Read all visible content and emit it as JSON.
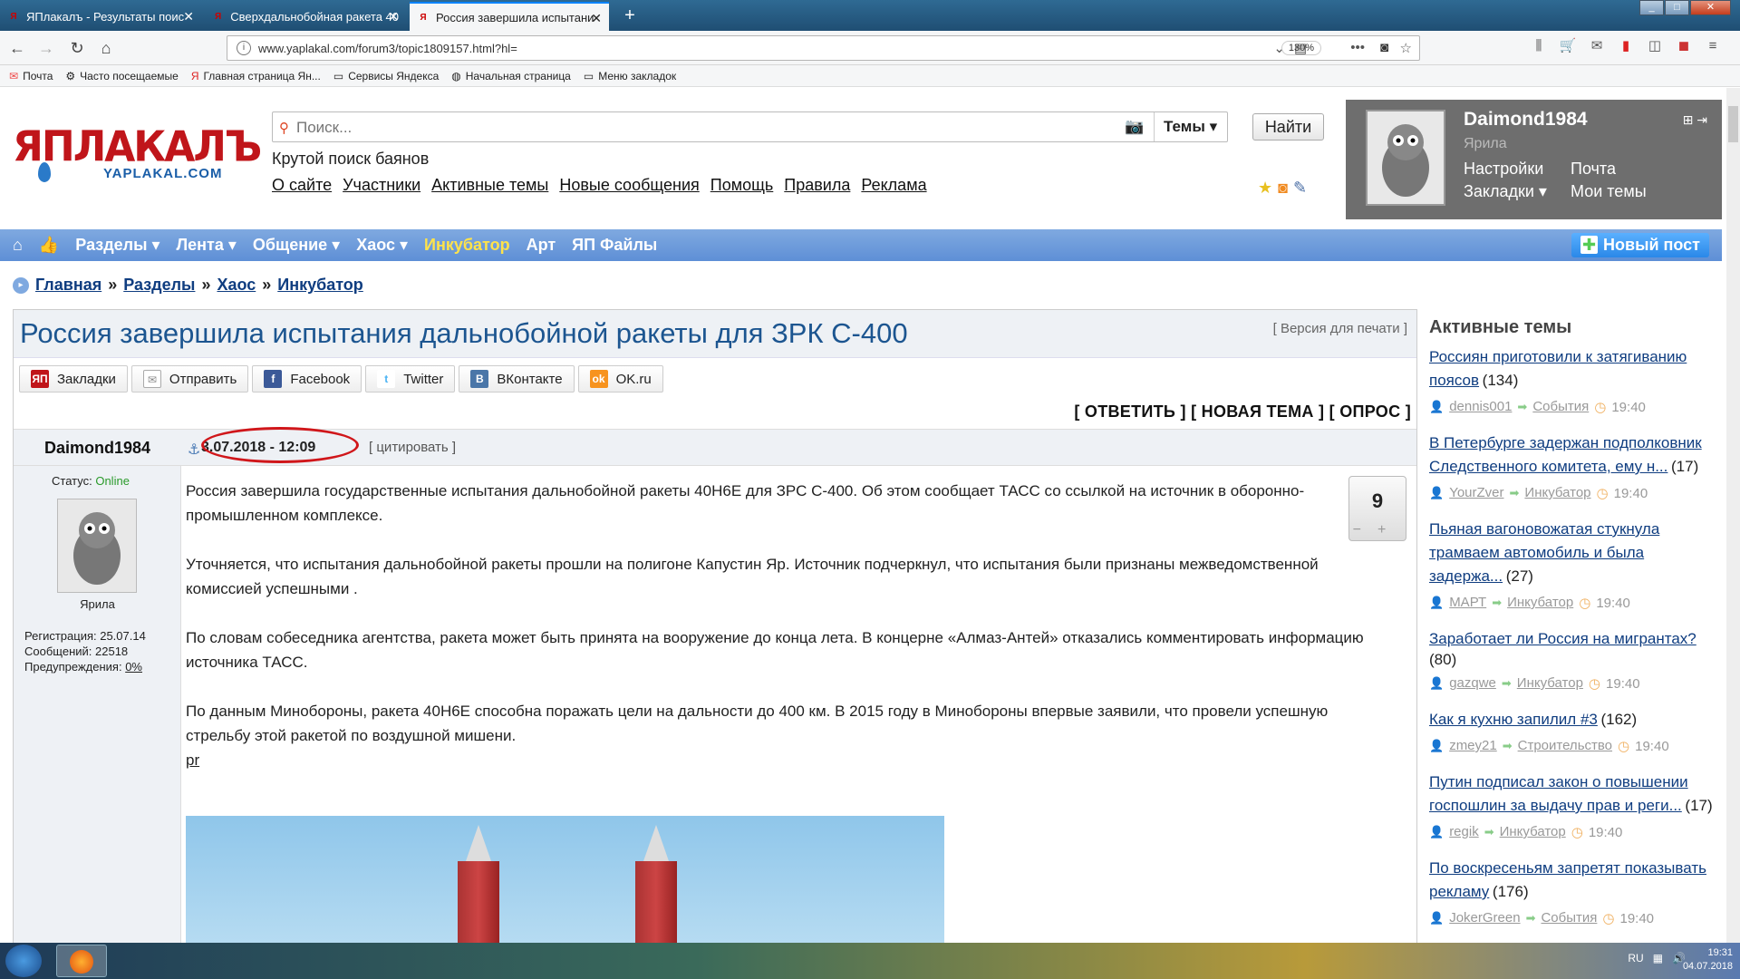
{
  "browser": {
    "tabs": [
      {
        "label": "ЯПлакалъ - Результаты поис",
        "active": false
      },
      {
        "label": "Сверхдальнобойная ракета 40",
        "active": false
      },
      {
        "label": "Россия завершила испытани",
        "active": true
      }
    ],
    "url": "www.yaplakal.com/forum3/topic1809157.html?hl=",
    "zoom": "130%",
    "bookmarks": [
      "Почта",
      "Часто посещаемые",
      "Главная страница Ян...",
      "Сервисы Яндекса",
      "Начальная страница",
      "Меню закладок"
    ]
  },
  "header": {
    "logo_text": "ЯПЛАКАЛЪ",
    "logo_sub": "YAPLAKAL.COM",
    "search_placeholder": "Поиск...",
    "search_scope": "Темы ▾",
    "find_button": "Найти",
    "tagline": "Крутой поиск баянов",
    "links": [
      "О сайте",
      "Участники",
      "Активные темы",
      "Новые сообщения",
      "Помощь",
      "Правила",
      "Реклама"
    ]
  },
  "user": {
    "name": "Daimond1984",
    "rank": "Ярила",
    "links": {
      "settings": "Настройки",
      "mail": "Почта",
      "bookmarks": "Закладки ▾",
      "mythemes": "Мои темы"
    }
  },
  "menu": {
    "items": [
      "Разделы ▾",
      "Лента ▾",
      "Общение ▾",
      "Хаос ▾",
      "Инкубатор",
      "Арт",
      "ЯП Файлы"
    ],
    "new_post": "Новый пост"
  },
  "breadcrumb": [
    "Главная",
    "Разделы",
    "Хаос",
    "Инкубатор"
  ],
  "topic": {
    "title": "Россия завершила испытания дальнобойной ракеты для ЗРК С-400",
    "print_version": "Версия для печати",
    "share": [
      "Закладки",
      "Отправить",
      "Facebook",
      "Twitter",
      "ВКонтакте",
      "OK.ru"
    ],
    "reply_bar": "[ ОТВЕТИТЬ ] [ НОВАЯ ТЕМА ] [ ОПРОС ]"
  },
  "post": {
    "author": "Daimond1984",
    "date": "3.07.2018 - 12:09",
    "quote": "цитировать",
    "status_label": "Статус:",
    "status_value": "Online",
    "rank": "Ярила",
    "registered": "Регистрация: 25.07.14",
    "messages": "Сообщений: 22518",
    "warnings_label": "Предупреждения:",
    "warnings_value": "0%",
    "rating": "9",
    "paragraphs": [
      "Россия завершила государственные испытания дальнобойной ракеты 40Н6Е для ЗРС С-400. Об этом сообщает ТАСС со ссылкой на источник в оборонно-промышленном комплексе.",
      "Уточняется, что испытания дальнобойной ракеты прошли на полигоне Капустин Яр. Источник подчеркнул, что испытания были признаны межведомственной комиссией успешными .",
      "По словам собеседника агентства, ракета может быть принята на вооружение до конца лета. В концерне «Алмаз-Антей» отказались комментировать информацию источника ТАСС.",
      "По данным Минобороны, ракета 40Н6Е способна поражать цели на дальности до 400 км. В 2015 году в Минобороны впервые заявили, что провели успешную стрельбу этой ракетой по воздушной мишени."
    ],
    "source_link": "pr"
  },
  "sidebar": {
    "title": "Активные темы",
    "topics": [
      {
        "title": "Россиян приготовили к затягиванию поясов",
        "count": "(134)",
        "user": "dennis001",
        "section": "События",
        "time": "19:40"
      },
      {
        "title": "В Петербурге задержан подполковник Следственного комитета, ему н...",
        "count": "(17)",
        "user": "YourZver",
        "section": "Инкубатор",
        "time": "19:40"
      },
      {
        "title": "Пьяная вагоновожатая стукнула трамваем автомобиль и была задержа...",
        "count": "(27)",
        "user": "МАРТ",
        "section": "Инкубатор",
        "time": "19:40"
      },
      {
        "title": "Заработает ли Россия на мигрантах?",
        "count": "(80)",
        "user": "gazqwe",
        "section": "Инкубатор",
        "time": "19:40"
      },
      {
        "title": "Как я кухню запилил #3",
        "count": "(162)",
        "user": "zmey21",
        "section": "Строительство",
        "time": "19:40"
      },
      {
        "title": "Путин подписал закон о повышении госпошлин за выдачу прав и реги...",
        "count": "(17)",
        "user": "regik",
        "section": "Инкубатор",
        "time": "19:40"
      },
      {
        "title": "По воскресеньям запретят показывать рекламу",
        "count": "(176)",
        "user": "JokerGreen",
        "section": "События",
        "time": "19:40"
      }
    ]
  },
  "taskbar": {
    "lang": "RU",
    "time": "19:31",
    "date": "04.07.2018"
  }
}
